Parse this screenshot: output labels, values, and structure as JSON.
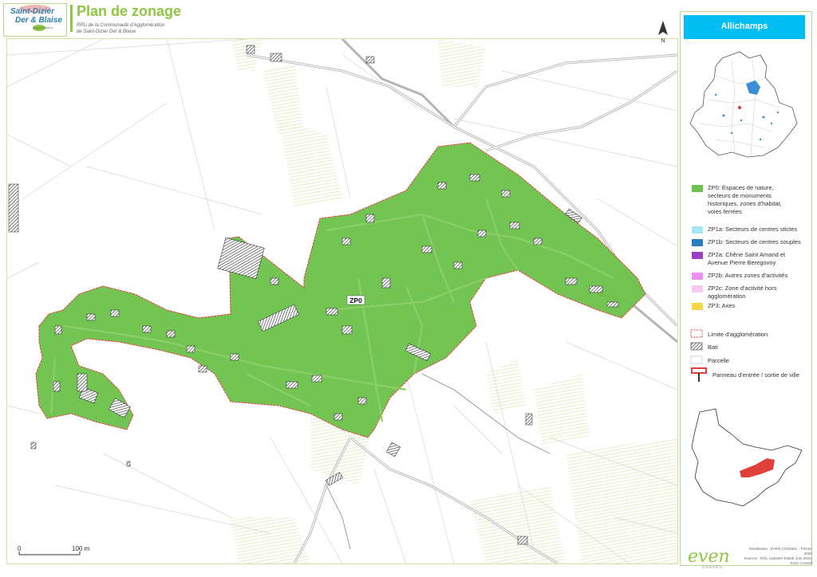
{
  "header": {
    "logo_line1": "Saint-Dizier",
    "logo_line2": "Der & Blaise",
    "logo_line3": "Agglomération",
    "title": "Plan de zonage",
    "subtitle_line1": "RPLi de la Communauté d'Agglomération",
    "subtitle_line2": "de Saint-Dizier Der & Blaise"
  },
  "map": {
    "zone_label": "ZP0",
    "north_label": "N",
    "scale_start": "0",
    "scale_end": "100 m",
    "colors": {
      "zone_fill": "#6cc24a",
      "zone_outline": "#e0403a",
      "road": "#b8b8b8",
      "parcel": "#cfcfcf",
      "green_hatch": "#d8e8a8"
    }
  },
  "sidebar": {
    "commune": "Allichamps",
    "legend": [
      {
        "swatch": "#6cc24a",
        "lines": [
          "ZP0: Espaces de nature,",
          "secteurs de monuments",
          "historiques, zones d'habitat,",
          "voies ferrées"
        ]
      },
      {
        "swatch": "#a6e6f5",
        "lines": [
          "ZP1a: Secteurs de centres stictes"
        ]
      },
      {
        "swatch": "#2b7dc4",
        "lines": [
          "ZP1b: Secteurs de centres souples"
        ]
      },
      {
        "swatch": "#9b3fc9",
        "lines": [
          "ZP2a: Chêne Saint Amand et",
          "Avenue Pierre Beregovoy"
        ]
      },
      {
        "swatch": "#ef8ff5",
        "lines": [
          "ZP2b: Autres zones d'activités"
        ]
      },
      {
        "swatch": "#f7c8f0",
        "lines": [
          "ZP2c: Zone d'activité hors",
          "agglomération"
        ]
      },
      {
        "swatch": "#f5d646",
        "lines": [
          "ZP3: Axes"
        ]
      }
    ],
    "legend2": [
      {
        "type": "dashed",
        "label": "Limite d'agglomération"
      },
      {
        "type": "hatch",
        "label": "Bati"
      },
      {
        "type": "parcel",
        "label": "Parcelle"
      },
      {
        "type": "sign",
        "label": "Panneau d'entrée / sortie de ville"
      }
    ]
  },
  "footer": {
    "logo": "even",
    "logo_sub": "CONSEIL",
    "credit_line1": "Réalisation : EVEN CONSEIL - Février 2020",
    "credit_line2": "Sources : IGN, cadastre Etalab Juin 2019,",
    "credit_line3": "Even Conseil"
  }
}
